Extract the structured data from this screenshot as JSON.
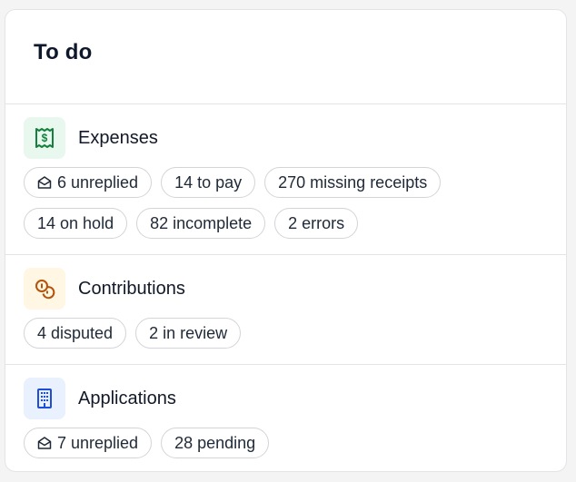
{
  "card": {
    "title": "To do"
  },
  "sections": [
    {
      "title": "Expenses",
      "icon": "receipt-dollar-icon",
      "icon_bg": "#e9f8ee",
      "icon_color": "#15803d",
      "pills": [
        {
          "label": "6 unreplied",
          "icon": "envelope-open-icon"
        },
        {
          "label": "14 to pay"
        },
        {
          "label": "270 missing receipts"
        },
        {
          "label": "14 on hold"
        },
        {
          "label": "82 incomplete"
        },
        {
          "label": "2 errors"
        }
      ]
    },
    {
      "title": "Contributions",
      "icon": "coins-icon",
      "icon_bg": "#fff6e4",
      "icon_color": "#b45309",
      "pills": [
        {
          "label": "4 disputed"
        },
        {
          "label": "2 in review"
        }
      ]
    },
    {
      "title": "Applications",
      "icon": "building-icon",
      "icon_bg": "#eaf1fe",
      "icon_color": "#1d4ed8",
      "pills": [
        {
          "label": "7 unreplied",
          "icon": "envelope-open-icon"
        },
        {
          "label": "28 pending"
        }
      ]
    }
  ]
}
